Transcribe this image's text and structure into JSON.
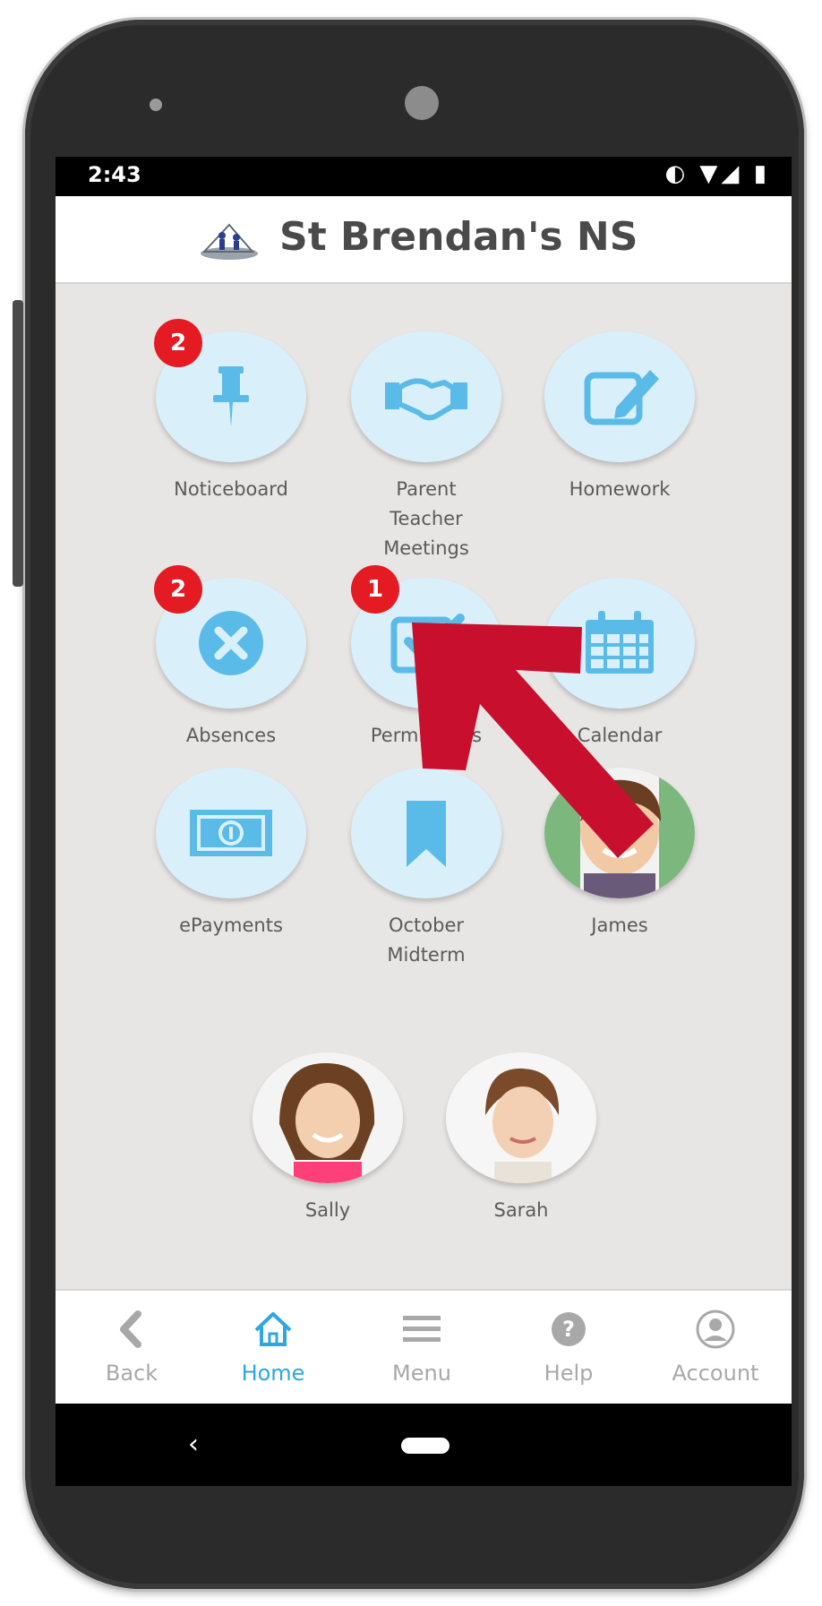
{
  "status": {
    "time": "2:43",
    "icons": "◐ ▼◢ ▮"
  },
  "header": {
    "school_name": "St Brendan's NS",
    "logo_icon": "school-logo-icon"
  },
  "tiles": [
    {
      "label": "Noticeboard",
      "icon": "pushpin-icon",
      "badge": "2"
    },
    {
      "label": "Parent\nTeacher\nMeetings",
      "icon": "handshake-icon"
    },
    {
      "label": "Homework",
      "icon": "edit-icon"
    },
    {
      "label": "Absences",
      "icon": "x-circle-icon",
      "badge": "2"
    },
    {
      "label": "Permissions",
      "icon": "checkbox-icon",
      "badge": "1"
    },
    {
      "label": "Calendar",
      "icon": "calendar-icon"
    },
    {
      "label": "ePayments",
      "icon": "banknote-icon"
    },
    {
      "label": "October\nMidterm",
      "icon": "bookmark-icon"
    },
    {
      "label": "James",
      "icon": "child-photo-avatar"
    },
    {
      "label": "Sally",
      "icon": "child-photo-avatar"
    },
    {
      "label": "Sarah",
      "icon": "child-photo-avatar"
    }
  ],
  "bottom_nav": [
    {
      "label": "Back",
      "icon": "chevron-left-icon"
    },
    {
      "label": "Home",
      "icon": "home-icon",
      "active": true
    },
    {
      "label": "Menu",
      "icon": "hamburger-icon"
    },
    {
      "label": "Help",
      "icon": "help-icon"
    },
    {
      "label": "Account",
      "icon": "account-icon"
    }
  ],
  "android_nav": {
    "back": "‹"
  },
  "colors": {
    "icon_blue": "#5bbbe8",
    "tile_bg": "#d9f0fb",
    "badge_red": "#e41b23",
    "active_blue": "#2ea7e0",
    "arrow_red": "#c8102e"
  }
}
